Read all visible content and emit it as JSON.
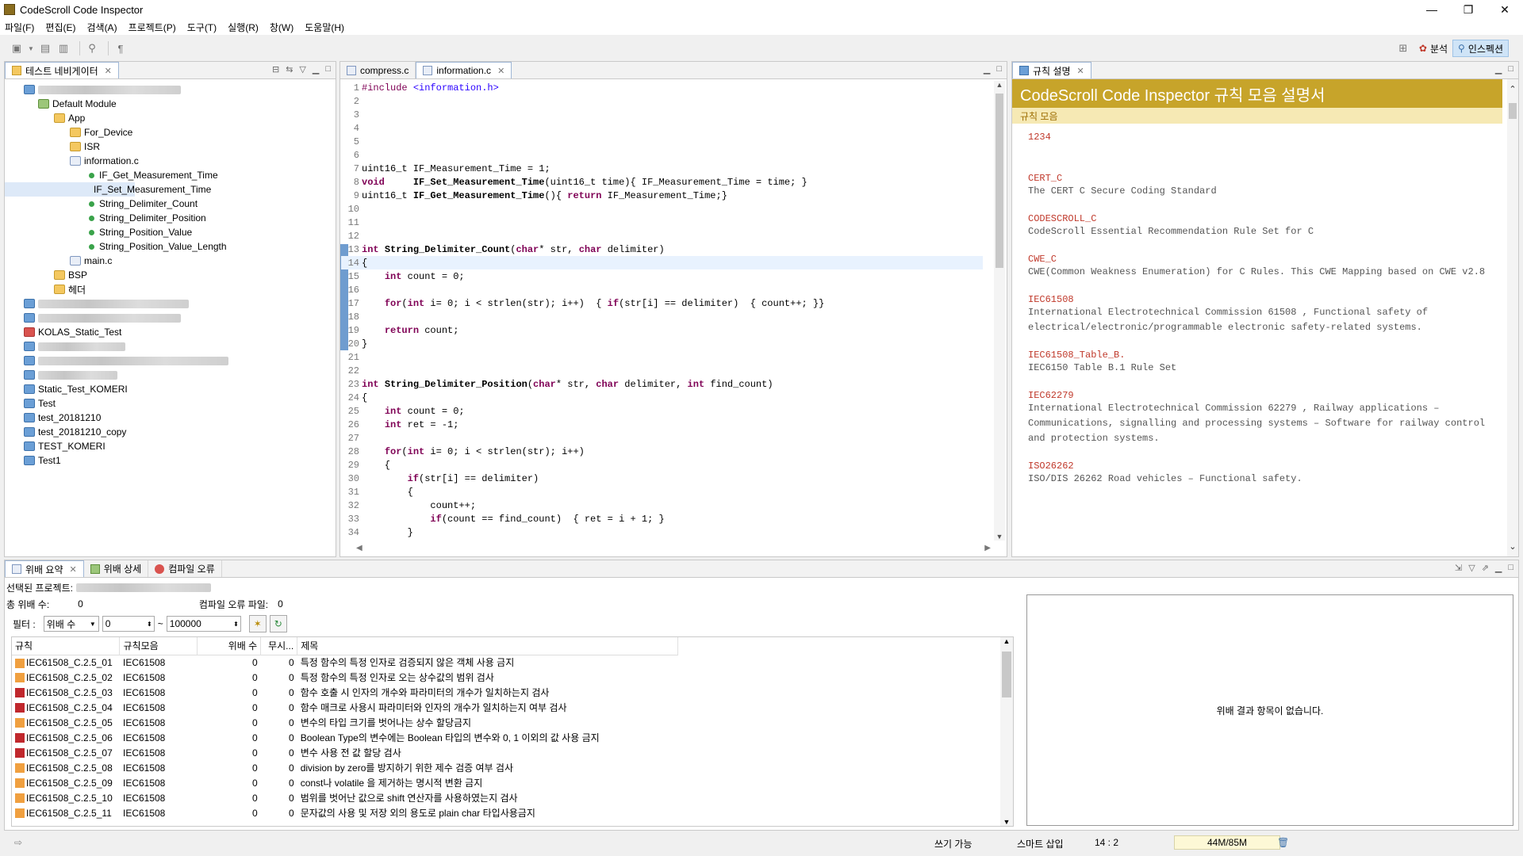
{
  "window": {
    "title": "CodeScroll Code Inspector",
    "min": "—",
    "max": "❐",
    "close": "✕"
  },
  "menu": [
    "파일(F)",
    "편집(E)",
    "검색(A)",
    "프로젝트(P)",
    "도구(T)",
    "실행(R)",
    "창(W)",
    "도움말(H)"
  ],
  "perspectives": {
    "analysis": "분석",
    "inspection": "인스펙션"
  },
  "navigator": {
    "tab_label": "테스트 네비게이터",
    "tree": {
      "default_module": "Default Module",
      "app": "App",
      "for_device": "For_Device",
      "isr": "ISR",
      "information_c": "information.c",
      "functions": [
        "IF_Get_Measurement_Time",
        "IF_Set_Measurement_Time",
        "String_Delimiter_Count",
        "String_Delimiter_Position",
        "String_Position_Value",
        "String_Position_Value_Length"
      ],
      "main_c": "main.c",
      "bsp": "BSP",
      "header": "헤더",
      "projects": [
        "KOLAS_Static_Test",
        "Static_Test_KOMERI",
        "Test",
        "test_20181210",
        "test_20181210_copy",
        "TEST_KOMERI",
        "Test1"
      ]
    }
  },
  "editor": {
    "tabs": [
      "compress.c",
      "information.c"
    ],
    "lines": [
      {
        "n": "1",
        "code": "#include <information.h>"
      },
      {
        "n": "2",
        "code": ""
      },
      {
        "n": "3",
        "code": ""
      },
      {
        "n": "4",
        "code": ""
      },
      {
        "n": "5",
        "code": ""
      },
      {
        "n": "6",
        "code": ""
      },
      {
        "n": "7",
        "code": "uint16_t IF_Measurement_Time = 1;"
      },
      {
        "n": "8",
        "code": "void     IF_Set_Measurement_Time(uint16_t time){ IF_Measurement_Time = time; }"
      },
      {
        "n": "9",
        "code": "uint16_t IF_Get_Measurement_Time(){ return IF_Measurement_Time;}"
      },
      {
        "n": "10",
        "code": ""
      },
      {
        "n": "11",
        "code": ""
      },
      {
        "n": "12",
        "code": ""
      },
      {
        "n": "13",
        "code": "int String_Delimiter_Count(char* str, char delimiter)"
      },
      {
        "n": "14",
        "code": "{"
      },
      {
        "n": "15",
        "code": "    int count = 0;"
      },
      {
        "n": "16",
        "code": ""
      },
      {
        "n": "17",
        "code": "    for(int i= 0; i < strlen(str); i++)  { if(str[i] == delimiter)  { count++; }}"
      },
      {
        "n": "18",
        "code": ""
      },
      {
        "n": "19",
        "code": "    return count;"
      },
      {
        "n": "20",
        "code": "}"
      },
      {
        "n": "21",
        "code": ""
      },
      {
        "n": "22",
        "code": ""
      },
      {
        "n": "23",
        "code": "int String_Delimiter_Position(char* str, char delimiter, int find_count)"
      },
      {
        "n": "24",
        "code": "{"
      },
      {
        "n": "25",
        "code": "    int count = 0;"
      },
      {
        "n": "26",
        "code": "    int ret = -1;"
      },
      {
        "n": "27",
        "code": ""
      },
      {
        "n": "28",
        "code": "    for(int i= 0; i < strlen(str); i++)"
      },
      {
        "n": "29",
        "code": "    {"
      },
      {
        "n": "30",
        "code": "        if(str[i] == delimiter)"
      },
      {
        "n": "31",
        "code": "        {"
      },
      {
        "n": "32",
        "code": "            count++;"
      },
      {
        "n": "33",
        "code": "            if(count == find_count)  { ret = i + 1; }"
      },
      {
        "n": "34",
        "code": "        }"
      }
    ]
  },
  "rules_panel": {
    "tab_label": "규칙 설명",
    "heading": "CodeScroll Code Inspector 규칙 모음 설명서",
    "subheading": "규칙 모음",
    "items": [
      {
        "name": "1234",
        "desc": ""
      },
      {
        "name": "CERT_C",
        "desc": "The CERT C Secure Coding Standard"
      },
      {
        "name": "CODESCROLL_C",
        "desc": "CodeScroll Essential Recommendation Rule Set for C"
      },
      {
        "name": "CWE_C",
        "desc": "CWE(Common Weakness Enumeration) for C Rules. This CWE Mapping based on CWE v2.8"
      },
      {
        "name": "IEC61508",
        "desc": "International Electrotechnical Commission 61508 , Functional safety of electrical/electronic/programmable electronic safety-related systems."
      },
      {
        "name": "IEC61508_Table_B.",
        "desc": "IEC6150 Table B.1 Rule Set"
      },
      {
        "name": "IEC62279",
        "desc": "International Electrotechnical Commission 62279 , Railway applications – Communications, signalling and processing systems – Software for railway control and protection systems."
      },
      {
        "name": "ISO26262",
        "desc": "ISO/DIS 26262 Road vehicles – Functional safety."
      }
    ]
  },
  "bottom": {
    "tabs": [
      "위배 요약",
      "위배 상세",
      "컴파일 오류"
    ],
    "selected_project_label": "선택된 프로젝트:",
    "total_label": "총 위배 수:",
    "total_value": "0",
    "compile_error_label": "컴파일 오류 파일:",
    "compile_error_value": "0",
    "filter_label": "필터 :",
    "filter_select": "위배 수",
    "filter_from": "0",
    "filter_tilde": "~",
    "filter_to": "100000",
    "columns": [
      "규칙",
      "규칙모음",
      "위배 수",
      "무시...",
      "제목"
    ],
    "rows": [
      {
        "rule": "IEC61508_C.2.5_01",
        "set": "IEC61508",
        "violations": "0",
        "ignored": "0",
        "title": "특정 함수의 특정 인자로 검증되지 않은 객체 사용 금지",
        "sev": "orange"
      },
      {
        "rule": "IEC61508_C.2.5_02",
        "set": "IEC61508",
        "violations": "0",
        "ignored": "0",
        "title": "특정 함수의 특정 인자로 오는 상수값의 범위 검사",
        "sev": "orange"
      },
      {
        "rule": "IEC61508_C.2.5_03",
        "set": "IEC61508",
        "violations": "0",
        "ignored": "0",
        "title": "함수 호출 시 인자의 개수와 파라미터의 개수가 일치하는지 검사",
        "sev": "red"
      },
      {
        "rule": "IEC61508_C.2.5_04",
        "set": "IEC61508",
        "violations": "0",
        "ignored": "0",
        "title": "함수 매크로 사용시 파라미터와 인자의 개수가 일치하는지 여부 검사",
        "sev": "red"
      },
      {
        "rule": "IEC61508_C.2.5_05",
        "set": "IEC61508",
        "violations": "0",
        "ignored": "0",
        "title": "변수의 타입 크기를 벗어나는 상수 할당금지",
        "sev": "orange"
      },
      {
        "rule": "IEC61508_C.2.5_06",
        "set": "IEC61508",
        "violations": "0",
        "ignored": "0",
        "title": "Boolean Type의 변수에는 Boolean 타입의 변수와 0, 1 이외의 값 사용 금지",
        "sev": "red"
      },
      {
        "rule": "IEC61508_C.2.5_07",
        "set": "IEC61508",
        "violations": "0",
        "ignored": "0",
        "title": "변수 사용 전 값 할당 검사",
        "sev": "red"
      },
      {
        "rule": "IEC61508_C.2.5_08",
        "set": "IEC61508",
        "violations": "0",
        "ignored": "0",
        "title": "division by zero를 방지하기 위한 제수 검증 여부 검사",
        "sev": "orange"
      },
      {
        "rule": "IEC61508_C.2.5_09",
        "set": "IEC61508",
        "violations": "0",
        "ignored": "0",
        "title": "const나 volatile 을 제거하는 명시적 변환 금지",
        "sev": "orange"
      },
      {
        "rule": "IEC61508_C.2.5_10",
        "set": "IEC61508",
        "violations": "0",
        "ignored": "0",
        "title": "범위를 벗어난 값으로 shift 연산자를 사용하였는지 검사",
        "sev": "orange"
      },
      {
        "rule": "IEC61508_C.2.5_11",
        "set": "IEC61508",
        "violations": "0",
        "ignored": "0",
        "title": "문자값의 사용 및 저장 외의 용도로 plain char 타입사용금지",
        "sev": "orange"
      }
    ],
    "empty_message": "위배 결과 항목이 없습니다."
  },
  "status": {
    "writable": "쓰기 가능",
    "insert_mode": "스마트 삽입",
    "position": "14 : 2",
    "memory": "44M/85M"
  },
  "colors": {
    "orange_sev": "#f0a040",
    "red_sev": "#c0282d",
    "rules_header": "#c7a42a"
  }
}
